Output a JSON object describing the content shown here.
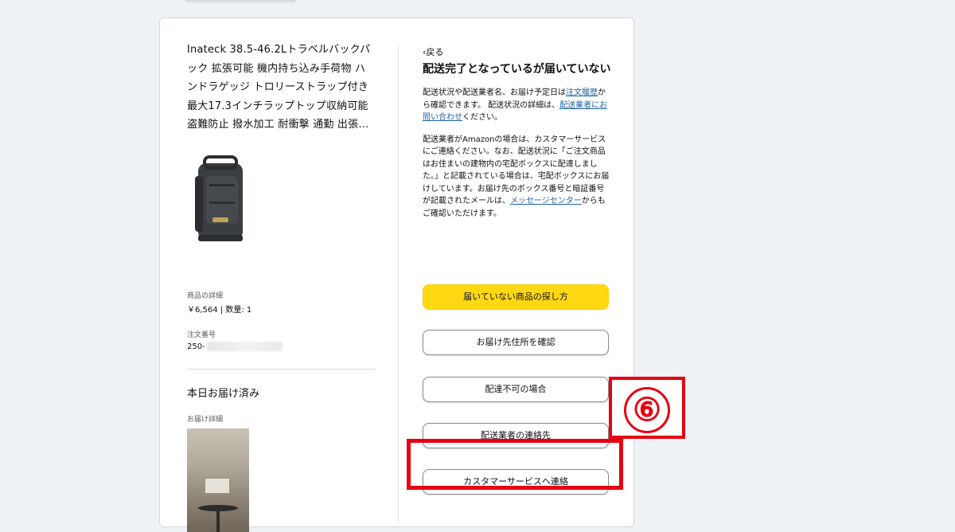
{
  "product": {
    "title": "Inateck 38.5-46.2Lトラベルバックパック 拡張可能 機内持ち込み手荷物 ハンドラゲッジ トロリーストラップ付き 最大17.3インチラップトップ収納可能 盗難防止 撥水加工 耐衝撃 通勤 出張…",
    "image_icon": "backpack-image",
    "details_label": "商品の詳細",
    "price_qty": "￥6,564 | 数量: 1",
    "order_number_label": "注文番号",
    "order_number_prefix": "250-"
  },
  "delivery": {
    "status_heading": "本日お届け済み",
    "details_label": "お届け詳細",
    "photo_icon": "delivery-photo"
  },
  "help": {
    "back_label": "戻る",
    "title": "配送完了となっているが届いていない",
    "para1": {
      "text_a": "配送状況や配送業者名、お届け予定日は",
      "link_a": "注文履歴",
      "text_b": "から確認できます。 配送状況の詳細は、",
      "link_b": "配送業者にお問い合わせ",
      "text_c": "ください。"
    },
    "para2": {
      "text_a": "配送業者がAmazonの場合は、カスタマーサービスにご連絡ください。なお、配送状況に「ご注文商品はお住まいの建物内の宅配ボックスに配達しました。」と記載されている場合は、宅配ボックスにお届けしています。お届け先のボックス番号と暗証番号が記載されたメールは、",
      "link_a": "メッセージセンター",
      "text_b": "からもご確認いただけます。"
    },
    "buttons": {
      "find_item": "届いていない商品の探し方",
      "check_address": "お届け先住所を確認",
      "undeliverable": "配達不可の場合",
      "carrier_contact": "配送業者の連絡先",
      "contact_cs": "カスタマーサービスへ連絡"
    }
  },
  "annotation": {
    "step_number": "⑥",
    "color": "#e60012"
  },
  "colors": {
    "primary_button": "#ffd814",
    "link": "#2162a1",
    "background": "#eef1f5"
  }
}
